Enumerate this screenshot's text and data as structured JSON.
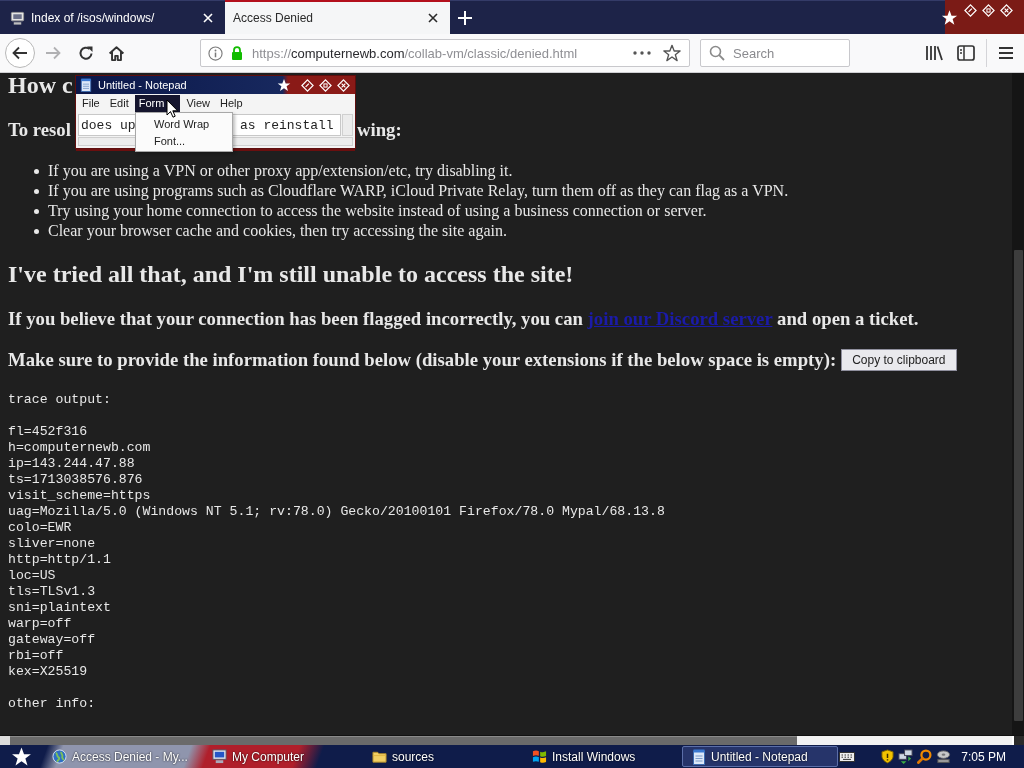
{
  "browser": {
    "tabs": [
      {
        "kind": "listing",
        "title": "Index of /isos/windows/",
        "selected": false
      },
      {
        "kind": "page",
        "title": "Access Denied",
        "selected": true
      }
    ],
    "toolbar": {
      "forward_disabled": true,
      "url": {
        "scheme": "https://",
        "host": "computernewb.com",
        "path": "/collab-vm/classic/denied.html"
      },
      "search_placeholder": "Search"
    }
  },
  "page": {
    "heading": "How c",
    "subheading_parts": [
      "To resol",
      "wing:"
    ],
    "tips": [
      "If you are using a VPN or other proxy app/extension/etc, try disabling it.",
      "If you are using programs such as Cloudflare WARP, iCloud Private Relay, turn them off as they can flag as a VPN.",
      "Try using your home connection to access the website instead of using a business connection or server.",
      "Clear your browser cache and cookies, then try accessing the site again."
    ],
    "heading_2": "I've tried all that, and I'm still unable to access the site!",
    "ticket_note": {
      "before": "If you believe that your connection has been flagged incorrectly, you can ",
      "link": "join our Discord server",
      "after": " and open a ticket."
    },
    "info_note": "Make sure to provide the information found below (disable your extensions if the below space is empty):",
    "copy_button": "Copy to clipboard",
    "trace_title": "trace output:",
    "trace_lines": [
      "fl=452f316",
      "h=computernewb.com",
      "ip=143.244.47.88",
      "ts=1713038576.876",
      "visit_scheme=https",
      "uag=Mozilla/5.0 (Windows NT 5.1; rv:78.0) Gecko/20100101 Firefox/78.0 Mypal/68.13.8",
      "colo=EWR",
      "sliver=none",
      "http=http/1.1",
      "loc=US",
      "tls=TLSv1.3",
      "sni=plaintext",
      "warp=off",
      "gateway=off",
      "rbi=off",
      "kex=X25519"
    ],
    "other_info": "other info:"
  },
  "notepad": {
    "title": "Untitled - Notepad",
    "menus": [
      {
        "label": "File",
        "selected": false
      },
      {
        "label": "Edit",
        "selected": false
      },
      {
        "label": "Form",
        "selected": true
      },
      {
        "label": "View",
        "selected": false
      },
      {
        "label": "Help",
        "selected": false
      }
    ],
    "text_parts": [
      "does up",
      "as reinstall"
    ],
    "menu_items": [
      "Word Wrap",
      "Font..."
    ]
  },
  "taskbar": {
    "items": [
      {
        "kind": "globe",
        "label": "Access Denied - My...",
        "selected": false
      },
      {
        "kind": "computer",
        "label": "My Computer",
        "selected": false
      },
      {
        "kind": "folder",
        "label": "sources",
        "selected": false
      },
      {
        "kind": "setup",
        "label": "Install Windows",
        "selected": false
      },
      {
        "kind": "notepad",
        "label": "Untitled - Notepad",
        "selected": true
      }
    ],
    "clock": "7:05 PM"
  }
}
